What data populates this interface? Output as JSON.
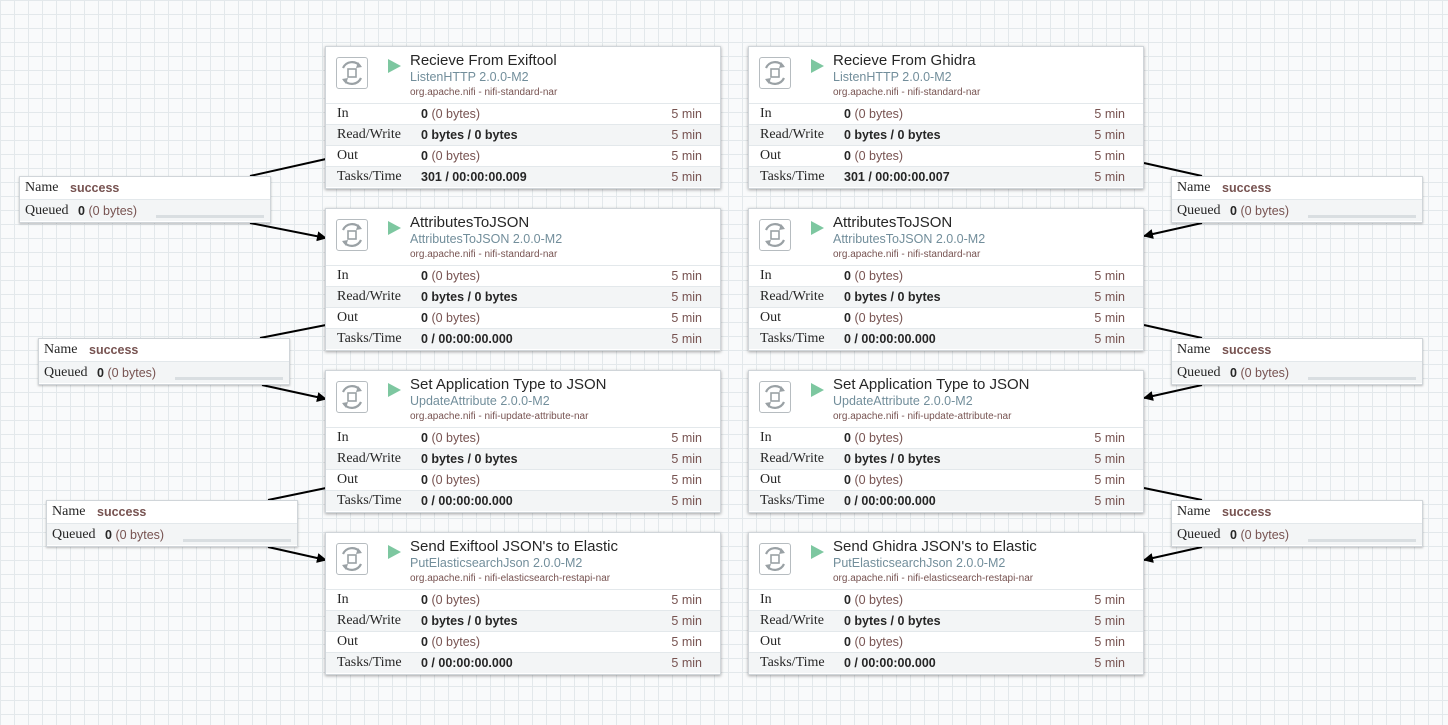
{
  "processors": [
    {
      "id": "p1",
      "name": "Recieve From Exiftool",
      "type": "ListenHTTP 2.0.0-M2",
      "bundle": "org.apache.nifi - nifi-standard-nar",
      "in_count": "0",
      "in_bytes": "(0 bytes)",
      "rw": "0 bytes / 0 bytes",
      "out_count": "0",
      "out_bytes": "(0 bytes)",
      "tasks": "301 / 00:00:00.009",
      "window": "5 min"
    },
    {
      "id": "p2",
      "name": "AttributesToJSON",
      "type": "AttributesToJSON 2.0.0-M2",
      "bundle": "org.apache.nifi - nifi-standard-nar",
      "in_count": "0",
      "in_bytes": "(0 bytes)",
      "rw": "0 bytes / 0 bytes",
      "out_count": "0",
      "out_bytes": "(0 bytes)",
      "tasks": "0 / 00:00:00.000",
      "window": "5 min"
    },
    {
      "id": "p3",
      "name": "Set Application Type to JSON",
      "type": "UpdateAttribute 2.0.0-M2",
      "bundle": "org.apache.nifi - nifi-update-attribute-nar",
      "in_count": "0",
      "in_bytes": "(0 bytes)",
      "rw": "0 bytes / 0 bytes",
      "out_count": "0",
      "out_bytes": "(0 bytes)",
      "tasks": "0 / 00:00:00.000",
      "window": "5 min"
    },
    {
      "id": "p4",
      "name": "Send Exiftool JSON's to Elastic",
      "type": "PutElasticsearchJson 2.0.0-M2",
      "bundle": "org.apache.nifi - nifi-elasticsearch-restapi-nar",
      "in_count": "0",
      "in_bytes": "(0 bytes)",
      "rw": "0 bytes / 0 bytes",
      "out_count": "0",
      "out_bytes": "(0 bytes)",
      "tasks": "0 / 00:00:00.000",
      "window": "5 min"
    },
    {
      "id": "p5",
      "name": "Recieve From Ghidra",
      "type": "ListenHTTP 2.0.0-M2",
      "bundle": "org.apache.nifi - nifi-standard-nar",
      "in_count": "0",
      "in_bytes": "(0 bytes)",
      "rw": "0 bytes / 0 bytes",
      "out_count": "0",
      "out_bytes": "(0 bytes)",
      "tasks": "301 / 00:00:00.007",
      "window": "5 min"
    },
    {
      "id": "p6",
      "name": "AttributesToJSON",
      "type": "AttributesToJSON 2.0.0-M2",
      "bundle": "org.apache.nifi - nifi-standard-nar",
      "in_count": "0",
      "in_bytes": "(0 bytes)",
      "rw": "0 bytes / 0 bytes",
      "out_count": "0",
      "out_bytes": "(0 bytes)",
      "tasks": "0 / 00:00:00.000",
      "window": "5 min"
    },
    {
      "id": "p7",
      "name": "Set Application Type to JSON",
      "type": "UpdateAttribute 2.0.0-M2",
      "bundle": "org.apache.nifi - nifi-update-attribute-nar",
      "in_count": "0",
      "in_bytes": "(0 bytes)",
      "rw": "0 bytes / 0 bytes",
      "out_count": "0",
      "out_bytes": "(0 bytes)",
      "tasks": "0 / 00:00:00.000",
      "window": "5 min"
    },
    {
      "id": "p8",
      "name": "Send Ghidra JSON's to Elastic",
      "type": "PutElasticsearchJson 2.0.0-M2",
      "bundle": "org.apache.nifi - nifi-elasticsearch-restapi-nar",
      "in_count": "0",
      "in_bytes": "(0 bytes)",
      "rw": "0 bytes / 0 bytes",
      "out_count": "0",
      "out_bytes": "(0 bytes)",
      "tasks": "0 / 00:00:00.000",
      "window": "5 min"
    }
  ],
  "labels": {
    "in": "In",
    "rw": "Read/Write",
    "out": "Out",
    "tasks": "Tasks/Time",
    "name": "Name",
    "queued": "Queued"
  },
  "connections": [
    {
      "id": "c1",
      "name": "success",
      "queued_count": "0",
      "queued_bytes": "(0 bytes)"
    },
    {
      "id": "c2",
      "name": "success",
      "queued_count": "0",
      "queued_bytes": "(0 bytes)"
    },
    {
      "id": "c3",
      "name": "success",
      "queued_count": "0",
      "queued_bytes": "(0 bytes)"
    },
    {
      "id": "c4",
      "name": "success",
      "queued_count": "0",
      "queued_bytes": "(0 bytes)"
    },
    {
      "id": "c5",
      "name": "success",
      "queued_count": "0",
      "queued_bytes": "(0 bytes)"
    },
    {
      "id": "c6",
      "name": "success",
      "queued_count": "0",
      "queued_bytes": "(0 bytes)"
    }
  ],
  "colors": {
    "run_state": "#7dc7a0",
    "stat_value": "#775351",
    "type_text": "#728e9b"
  },
  "icons": {
    "processor": "processor-icon",
    "run": "run-state-icon"
  }
}
